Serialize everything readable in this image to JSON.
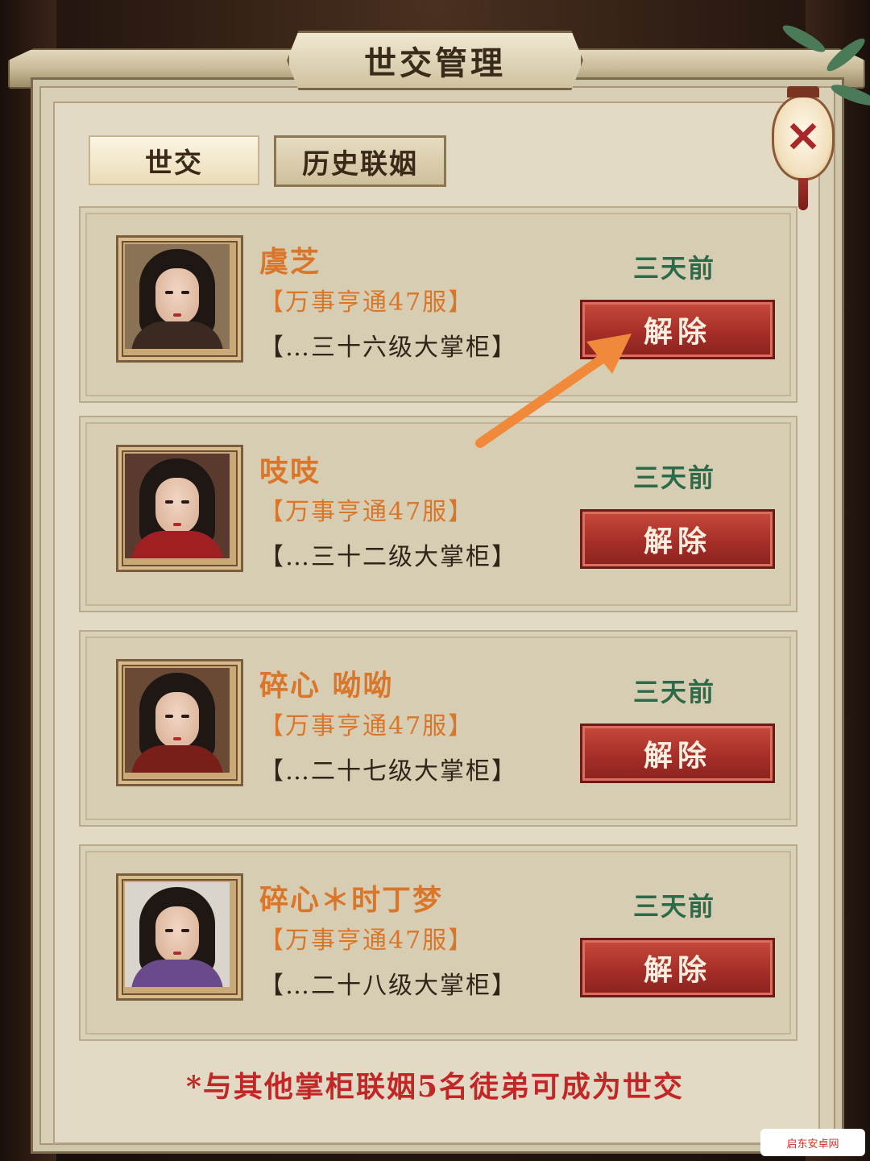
{
  "window": {
    "title": "世交管理"
  },
  "tabs": [
    {
      "label": "世交",
      "active": true
    },
    {
      "label": "历史联姻",
      "active": false
    }
  ],
  "entries": [
    {
      "name": "虞芝",
      "server": "【万事亨通47服】",
      "rank": "【…三十六级大掌柜】",
      "time": "三天前",
      "action": "解除",
      "avatar_bg": "#8a7256",
      "avatar_body": "#3b2a22"
    },
    {
      "name": "吱吱",
      "server": "【万事亨通47服】",
      "rank": "【…三十二级大掌柜】",
      "time": "三天前",
      "action": "解除",
      "avatar_bg": "#5a3a2e",
      "avatar_body": "#a01f22"
    },
    {
      "name": "碎心 呦呦",
      "server": "【万事亨通47服】",
      "rank": "【…二十七级大掌柜】",
      "time": "三天前",
      "action": "解除",
      "avatar_bg": "#6a4a34",
      "avatar_body": "#7a1e1a"
    },
    {
      "name": "碎心＊时丁梦",
      "server": "【万事亨通47服】",
      "rank": "【…二十八级大掌柜】",
      "time": "三天前",
      "action": "解除",
      "avatar_bg": "#d9d4cc",
      "avatar_body": "#6a4a8a"
    }
  ],
  "footer_note": "*与其他掌柜联姻5名徒弟可成为世交",
  "watermark": "启东安卓网",
  "colors": {
    "accent_red": "#a62f28",
    "name_orange": "#d9762a",
    "time_green": "#2d6a4a",
    "note_red": "#c22626"
  },
  "icons": {
    "close": "close-icon",
    "annotation": "arrow-pointer-icon"
  }
}
